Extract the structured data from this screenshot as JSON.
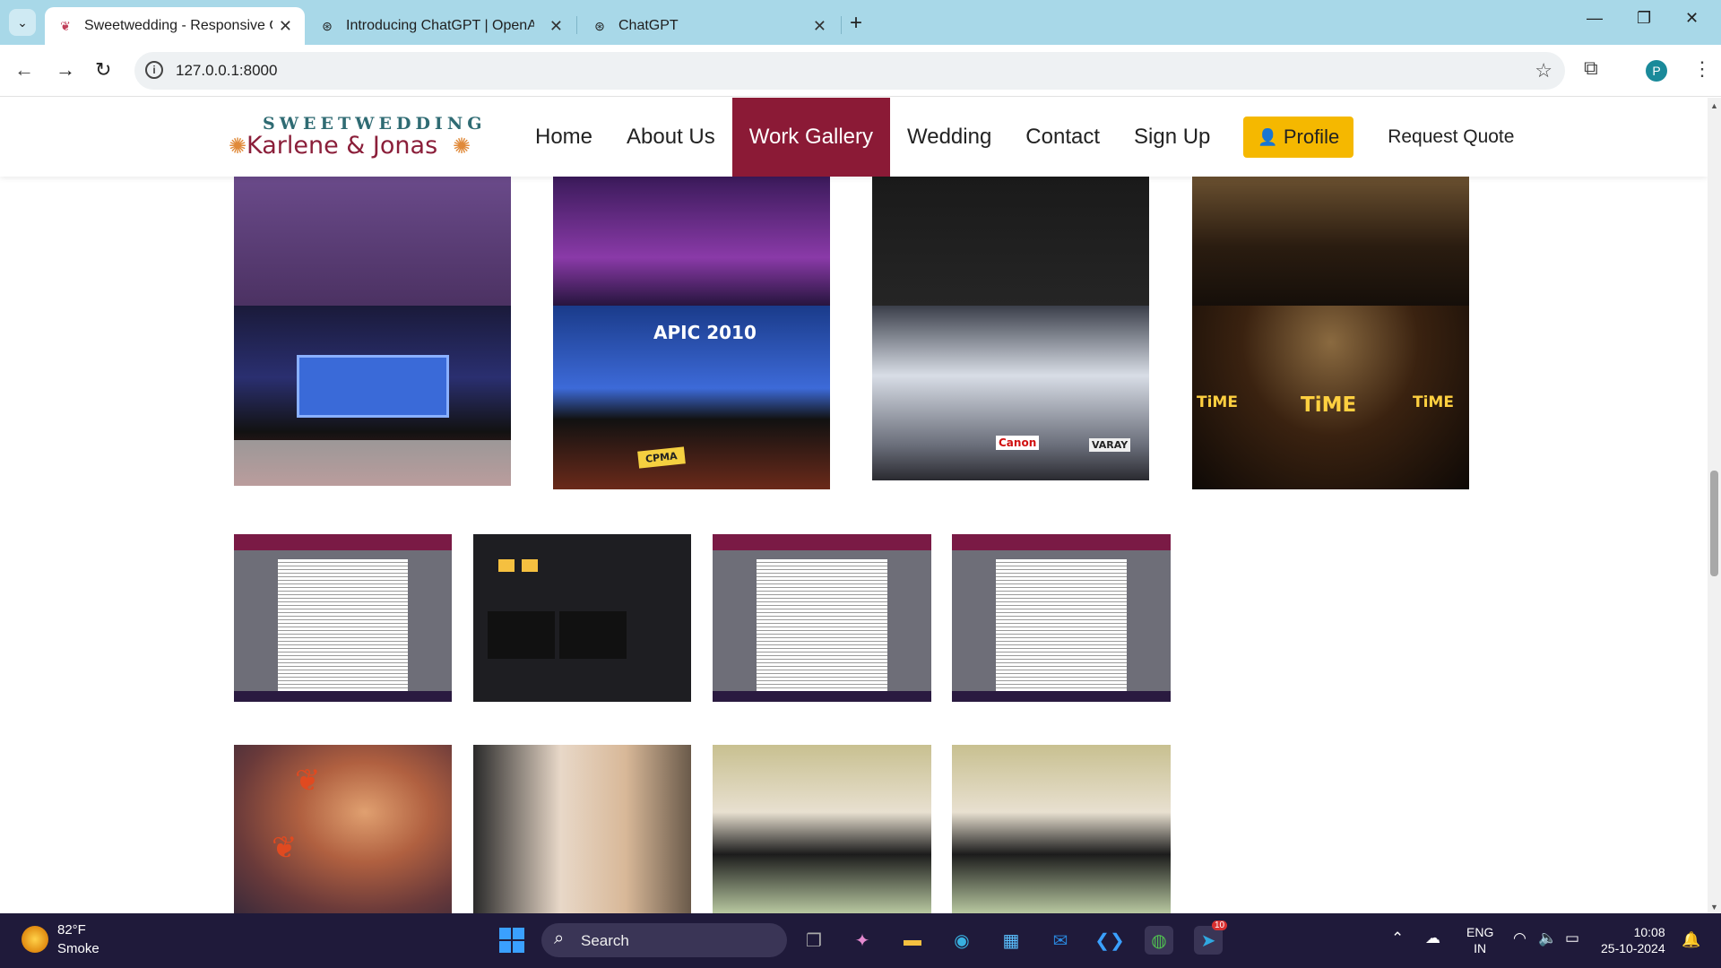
{
  "browser": {
    "tabs": [
      {
        "title": "Sweetwedding - Responsive On",
        "active": true
      },
      {
        "title": "Introducing ChatGPT | OpenAI",
        "active": false
      },
      {
        "title": "ChatGPT",
        "active": false
      }
    ],
    "url": "127.0.0.1:8000",
    "profile_initial": "P"
  },
  "site": {
    "logo": {
      "top": "SWEETWEDDING",
      "bottom": "Karlene & Jonas"
    },
    "nav": [
      "Home",
      "About Us",
      "Work Gallery",
      "Wedding",
      "Contact",
      "Sign Up"
    ],
    "active_nav": "Work Gallery",
    "profile_button": "Profile",
    "request_quote": "Request Quote",
    "accent_color": "#8b1a36",
    "profile_color": "#f5b800"
  },
  "gallery": {
    "apic_text": "APIC 2010",
    "cpma_text": "CPMA",
    "canon_text": "Canon",
    "varay_text": "VARAY",
    "time_text": "TiME"
  },
  "taskbar": {
    "temperature": "82°F",
    "condition": "Smoke",
    "search_placeholder": "Search",
    "telegram_badge": "10",
    "language": "ENG",
    "region": "IN",
    "time": "10:08",
    "date": "25-10-2024"
  }
}
